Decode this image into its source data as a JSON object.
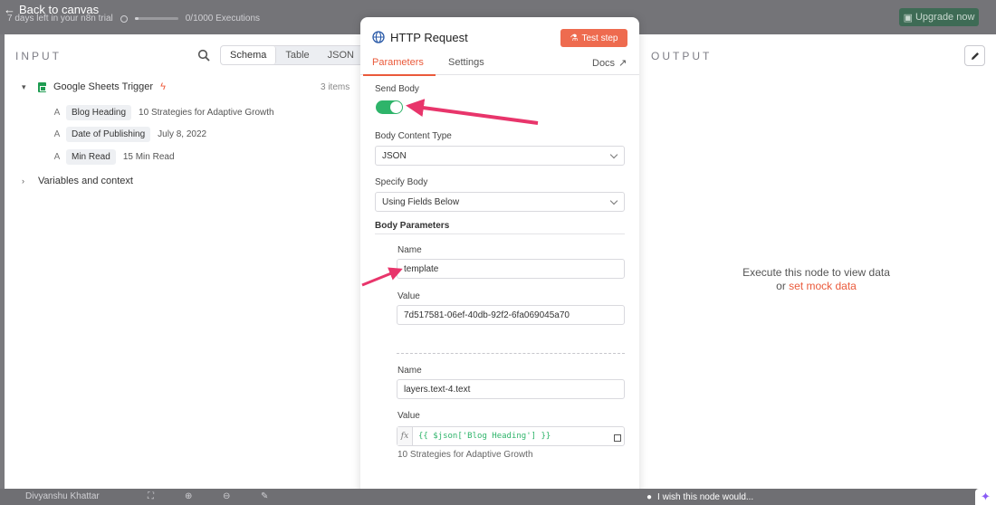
{
  "canvas": {
    "back_label": "Back to canvas",
    "trial_text": "7 days left in your n8n trial",
    "executions_text": "0/1000 Executions",
    "executions_fraction": 0.0,
    "upgrade_label": "Upgrade now",
    "user_name": "Divyanshu Khattar"
  },
  "input": {
    "title": "INPUT",
    "tabs": [
      "Schema",
      "Table",
      "JSON"
    ],
    "active_tab": "Schema",
    "trigger_name": "Google Sheets Trigger",
    "items_count": "3 items",
    "fields": [
      {
        "type": "A",
        "name": "Blog Heading",
        "value": "10 Strategies for Adaptive Growth"
      },
      {
        "type": "A",
        "name": "Date of Publishing",
        "value": "July 8, 2022"
      },
      {
        "type": "A",
        "name": "Min Read",
        "value": "15 Min Read"
      }
    ],
    "variables_label": "Variables and context"
  },
  "node": {
    "title": "HTTP Request",
    "test_label": "Test step",
    "tabs": {
      "parameters": "Parameters",
      "settings": "Settings",
      "docs": "Docs"
    },
    "send_body_label": "Send Body",
    "send_body_on": true,
    "body_content_type_label": "Body Content Type",
    "body_content_type_value": "JSON",
    "specify_body_label": "Specify Body",
    "specify_body_value": "Using Fields Below",
    "body_params_label": "Body Parameters",
    "params": [
      {
        "name_label": "Name",
        "name_value": "template",
        "value_label": "Value",
        "value_value": "7d517581-06ef-40db-92f2-6fa069045a70"
      },
      {
        "name_label": "Name",
        "name_value": "layers.text-4.text",
        "value_label": "Value",
        "value_expr": "{{ $json['Blog Heading'] }}",
        "value_preview": "10 Strategies for Adaptive Growth"
      }
    ]
  },
  "output": {
    "title": "OUTPUT",
    "message": "Execute this node to view data",
    "or_text": "or",
    "mock_link": "set mock data"
  },
  "footer": {
    "wish_text": "I wish this node would..."
  },
  "colors": {
    "accent": "#ea5a3b",
    "toggle_on": "#2eb46a",
    "annotation_arrow": "#e8356b"
  }
}
